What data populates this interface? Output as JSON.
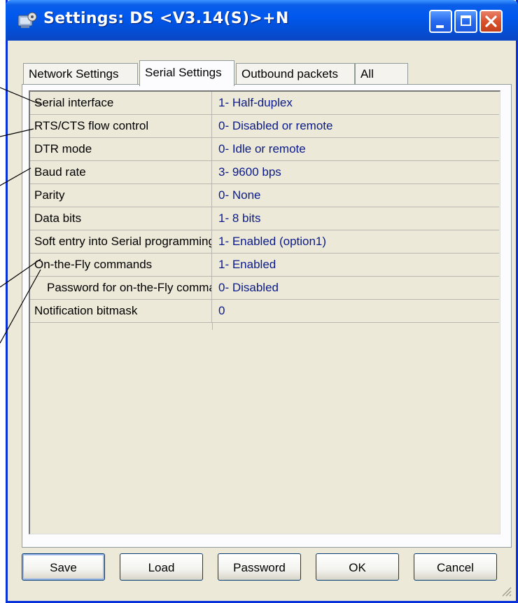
{
  "window": {
    "title": "Settings: DS <V3.14(S)>+N"
  },
  "tabs": [
    {
      "label": "Network Settings"
    },
    {
      "label": "Serial Settings"
    },
    {
      "label": "Outbound packets"
    },
    {
      "label": "All"
    }
  ],
  "active_tab": "Serial Settings",
  "rows": [
    {
      "label": "Serial interface",
      "value": "1- Half-duplex"
    },
    {
      "label": "RTS/CTS flow control",
      "value": "0- Disabled or remote"
    },
    {
      "label": "DTR mode",
      "value": "0- Idle or remote"
    },
    {
      "label": "Baud rate",
      "value": "3- 9600 bps"
    },
    {
      "label": "Parity",
      "value": "0- None"
    },
    {
      "label": "Data bits",
      "value": "1- 8 bits"
    },
    {
      "label": "Soft entry into Serial programming mode",
      "value": "1- Enabled (option1)"
    },
    {
      "label": "On-the-Fly commands",
      "value": "1- Enabled"
    },
    {
      "label": "Password for on-the-Fly commands",
      "value": "0- Disabled"
    },
    {
      "label": "Notification bitmask",
      "value": "0"
    }
  ],
  "buttons": {
    "save": "Save",
    "load": "Load",
    "password": "Password",
    "ok": "OK",
    "cancel": "Cancel"
  },
  "colors": {
    "title_bar": "#0058ee",
    "value_text": "#0a1a8c",
    "close_button": "#d9512c"
  }
}
